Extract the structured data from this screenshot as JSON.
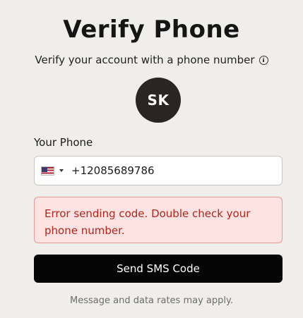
{
  "page": {
    "title": "Verify Phone",
    "subtitle": "Verify your account with a phone number",
    "info_icon": "info-circle-icon"
  },
  "avatar": {
    "initials": "SK"
  },
  "phone_field": {
    "label": "Your Phone",
    "country_flag": "us-flag-icon",
    "value": "+12085689786"
  },
  "error": {
    "message": "Error sending code. Double check your phone number."
  },
  "actions": {
    "send_label": "Send SMS Code"
  },
  "footer": {
    "note": "Message and data rates may apply."
  },
  "colors": {
    "background": "#f0eeea",
    "avatar_bg": "#2a2422",
    "error_bg": "#fde2e2",
    "error_border": "#e39a9a",
    "error_text": "#b3261e",
    "button_bg": "#050505"
  }
}
